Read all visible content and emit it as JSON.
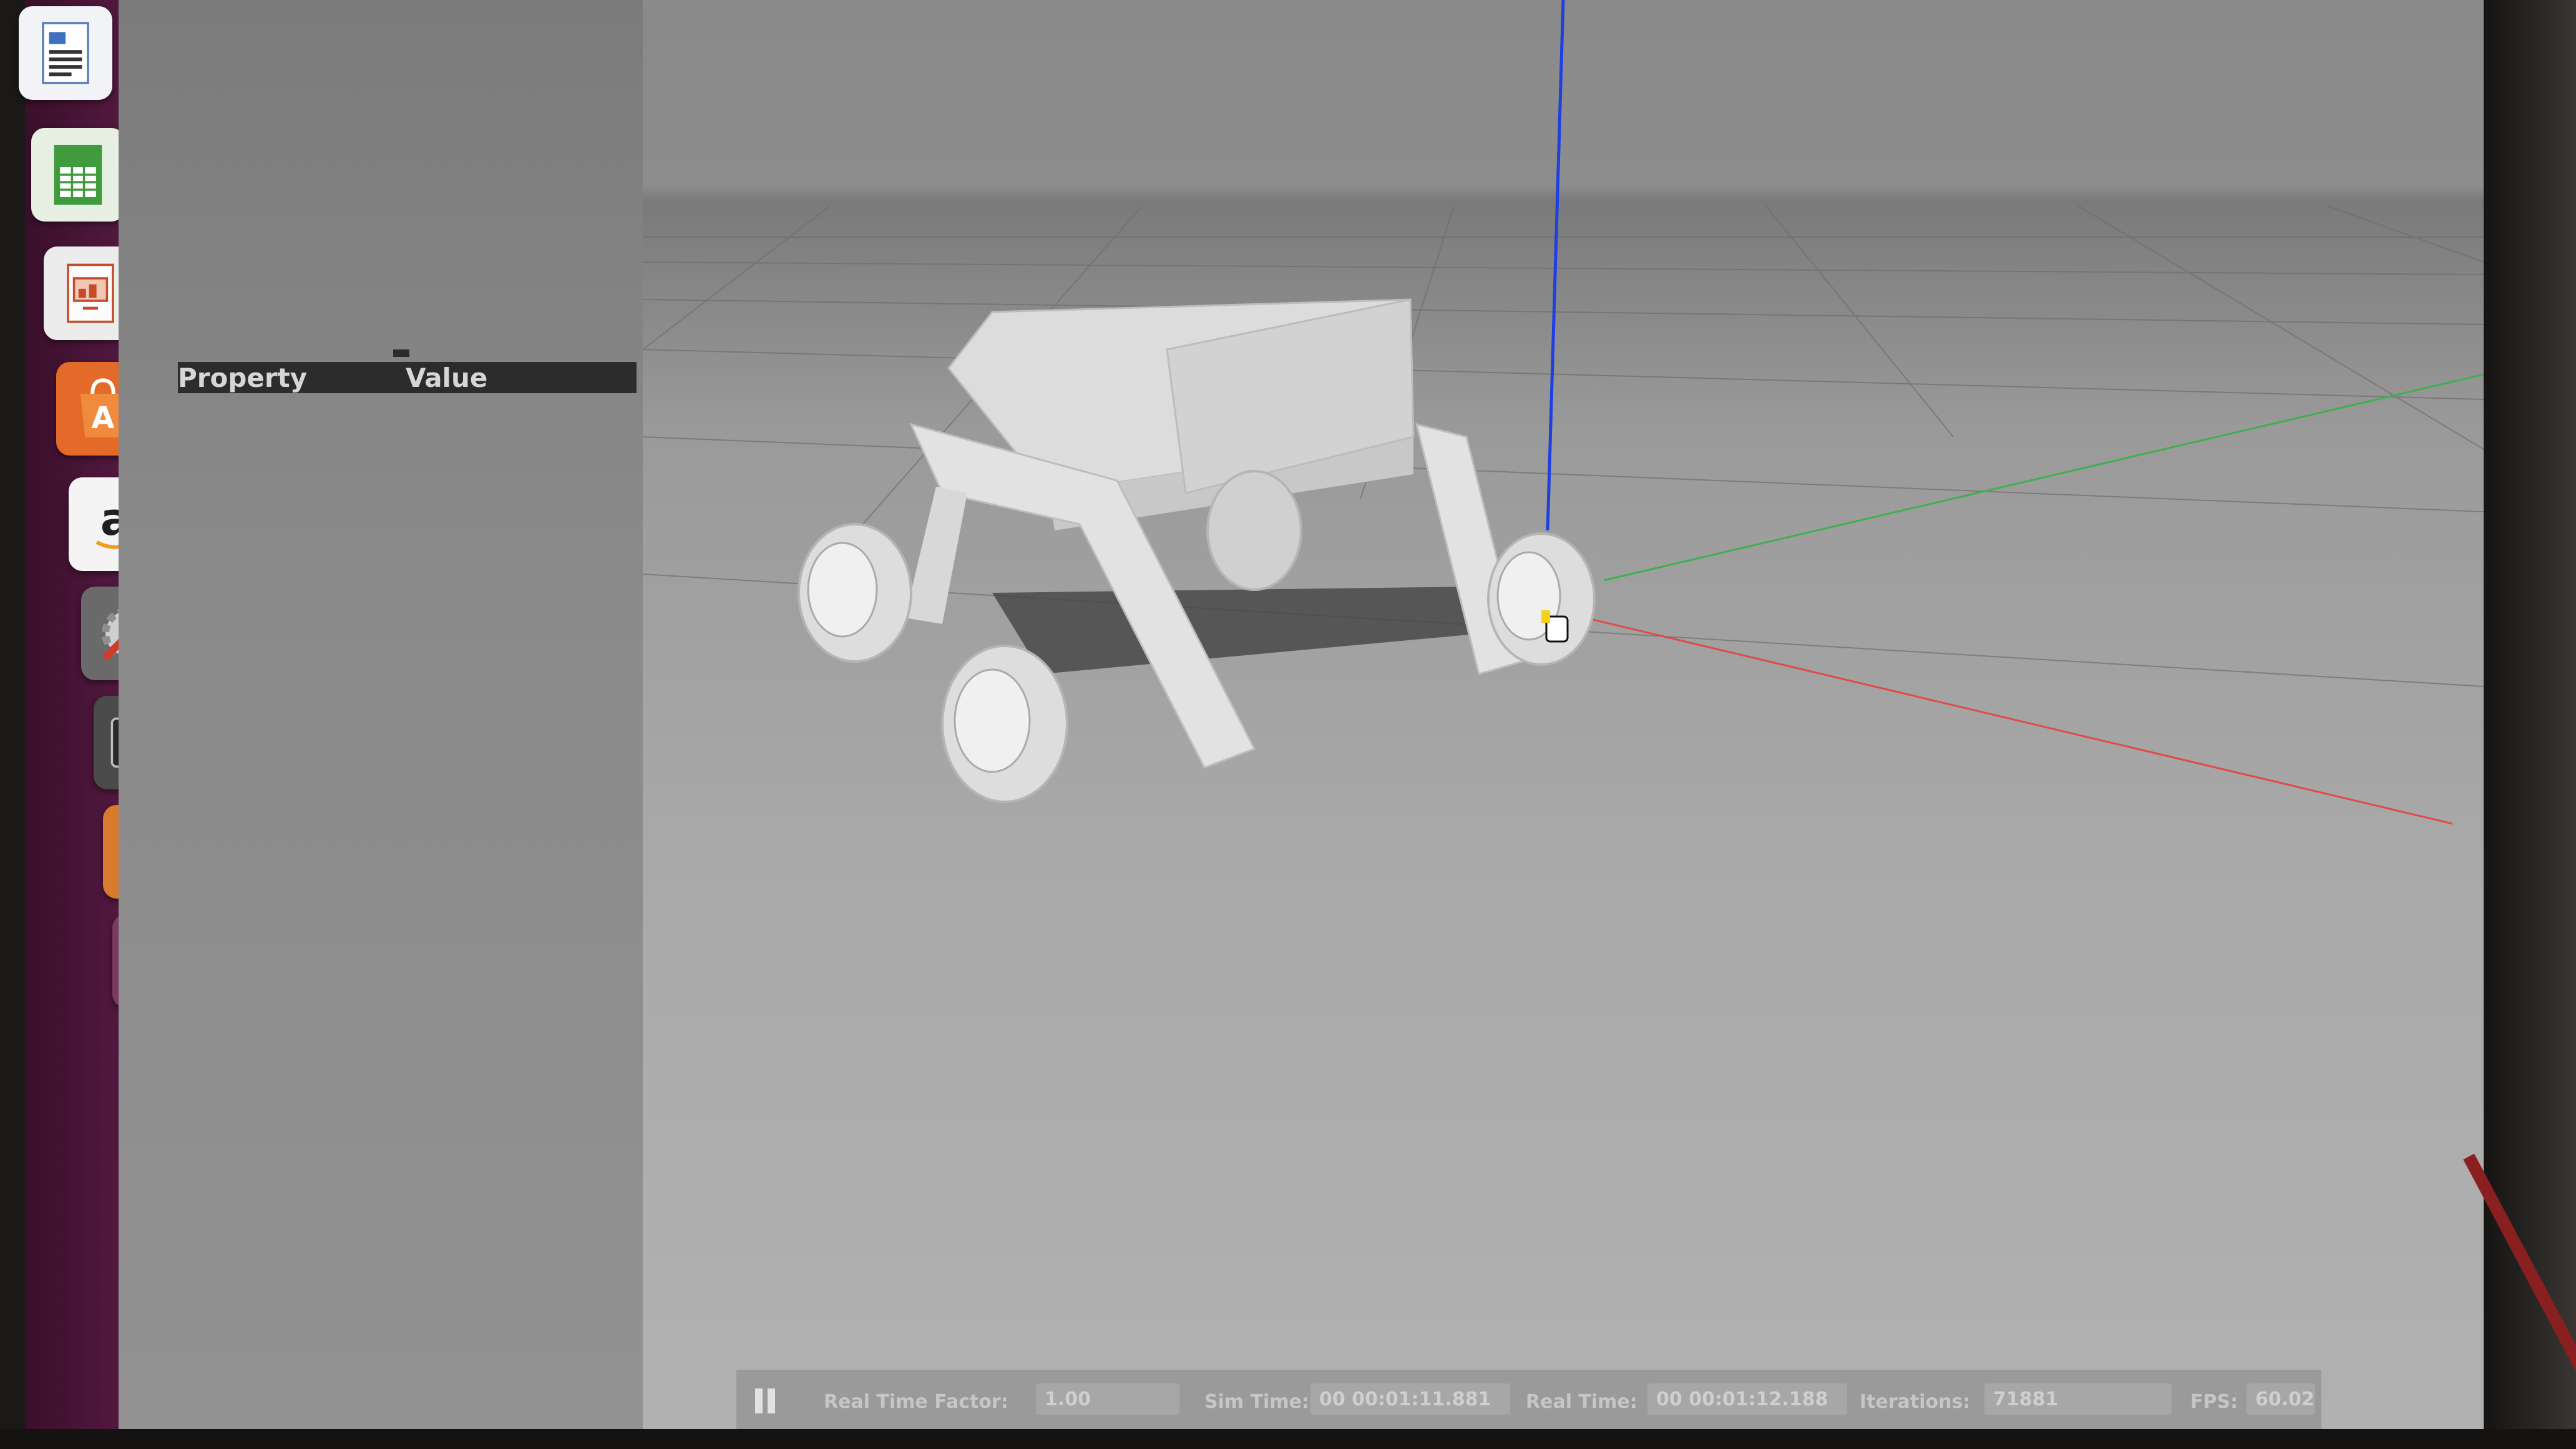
{
  "properties_panel": {
    "property_header": "Property",
    "value_header": "Value"
  },
  "launcher": {
    "items": [
      {
        "name": "libreoffice-writer",
        "color": "#eef0f5"
      },
      {
        "name": "libreoffice-calc",
        "color": "#3c9a3a"
      },
      {
        "name": "libreoffice-impress",
        "color": "#e9e9e9"
      },
      {
        "name": "ubuntu-software-center",
        "color": "#e46a2a"
      },
      {
        "name": "amazon",
        "color": "#f4f4f4"
      },
      {
        "name": "system-settings",
        "color": "#c94a3a"
      },
      {
        "name": "terminal",
        "color": "#2f2f2f"
      },
      {
        "name": "gazebo",
        "color": "#d87b2f"
      },
      {
        "name": "drive-1",
        "color": "#d8d8d8"
      },
      {
        "name": "drive-2",
        "color": "#d8d8d8"
      }
    ],
    "amazon_letter": "a",
    "software_letter": "A",
    "terminal_prompt": ">_"
  },
  "statusbar": {
    "real_time_factor_label": "Real Time Factor:",
    "real_time_factor_value": "1.00",
    "sim_time_label": "Sim Time:",
    "sim_time_value": "00 00:01:11.881",
    "real_time_label": "Real Time:",
    "real_time_value": "00 00:01:12.188",
    "iterations_label": "Iterations:",
    "iterations_value": "71881",
    "fps_label": "FPS:",
    "fps_value": "60.02"
  },
  "axis_colors": {
    "x": "#e04a4a",
    "y": "#3fb04f",
    "z": "#1f3fe0"
  }
}
